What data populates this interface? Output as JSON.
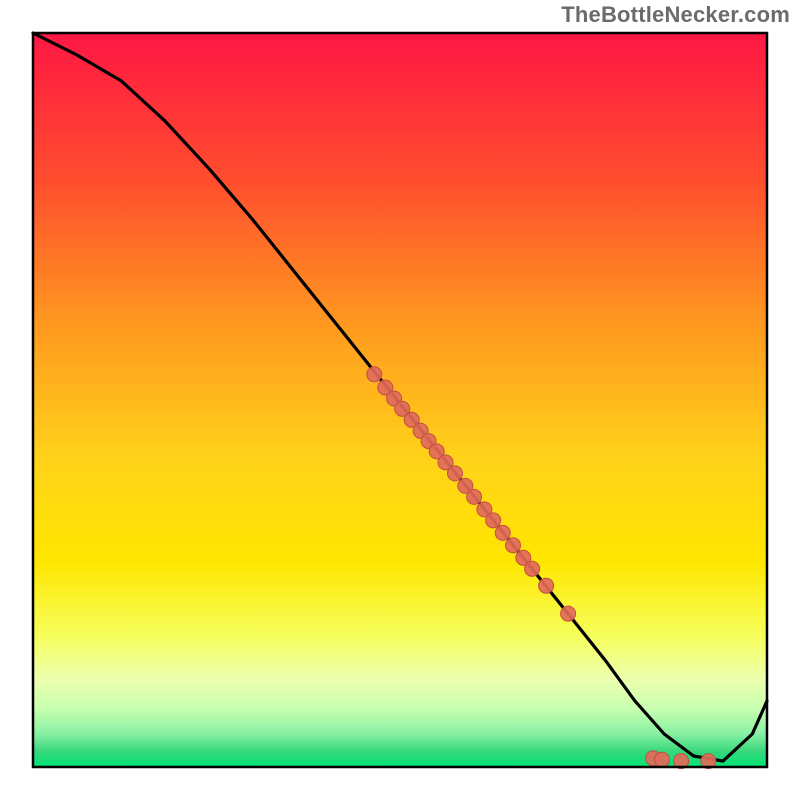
{
  "watermark": "TheBottleNecker.com",
  "colors": {
    "gradient_top": "#ff1744",
    "gradient_mid_upper": "#ff6f1a",
    "gradient_mid": "#ffe600",
    "gradient_lower1": "#f2ff66",
    "gradient_lower2": "#b3ff99",
    "gradient_bottom": "#00e676",
    "line": "#000000",
    "dot_fill": "#e26a5a",
    "dot_stroke": "#c14f41",
    "frame": "#000000"
  },
  "chart_data": {
    "type": "line",
    "title": "",
    "xlabel": "",
    "ylabel": "",
    "xlim": [
      0,
      100
    ],
    "ylim": [
      0,
      100
    ],
    "grid": false,
    "legend": false,
    "series": [
      {
        "name": "curve",
        "x": [
          0,
          6,
          12,
          18,
          24,
          30,
          36,
          42,
          48,
          54,
          60,
          66,
          72,
          78,
          82,
          86,
          90,
          94,
          98,
          100
        ],
        "y": [
          100,
          97,
          93.5,
          88,
          81.5,
          74.5,
          67,
          59.5,
          52,
          44.5,
          37,
          29.5,
          22,
          14.5,
          9,
          4.5,
          1.5,
          0.8,
          4.5,
          9
        ]
      }
    ],
    "scatter": [
      {
        "x": 46.5,
        "y": 53.5
      },
      {
        "x": 48.0,
        "y": 51.7
      },
      {
        "x": 49.2,
        "y": 50.2
      },
      {
        "x": 50.3,
        "y": 48.8
      },
      {
        "x": 51.6,
        "y": 47.3
      },
      {
        "x": 52.8,
        "y": 45.8
      },
      {
        "x": 53.9,
        "y": 44.4
      },
      {
        "x": 55.0,
        "y": 43.0
      },
      {
        "x": 56.2,
        "y": 41.5
      },
      {
        "x": 57.5,
        "y": 40.0
      },
      {
        "x": 58.9,
        "y": 38.3
      },
      {
        "x": 60.1,
        "y": 36.8
      },
      {
        "x": 61.5,
        "y": 35.1
      },
      {
        "x": 62.7,
        "y": 33.6
      },
      {
        "x": 64.0,
        "y": 31.9
      },
      {
        "x": 65.4,
        "y": 30.2
      },
      {
        "x": 66.8,
        "y": 28.5
      },
      {
        "x": 68.0,
        "y": 27.0
      },
      {
        "x": 69.9,
        "y": 24.7
      },
      {
        "x": 72.9,
        "y": 20.9
      },
      {
        "x": 84.5,
        "y": 1.2
      },
      {
        "x": 85.7,
        "y": 1.0
      },
      {
        "x": 88.3,
        "y": 0.8
      },
      {
        "x": 92.0,
        "y": 0.8
      }
    ],
    "band_stops": [
      {
        "offset": 0.0,
        "y": 100
      },
      {
        "offset": 0.5,
        "y": 50
      },
      {
        "offset": 0.78,
        "y": 22
      },
      {
        "offset": 0.86,
        "y": 14
      },
      {
        "offset": 0.9,
        "y": 10
      },
      {
        "offset": 0.93,
        "y": 7
      },
      {
        "offset": 0.955,
        "y": 4.5
      },
      {
        "offset": 0.975,
        "y": 2.5
      },
      {
        "offset": 1.0,
        "y": 0
      }
    ]
  }
}
